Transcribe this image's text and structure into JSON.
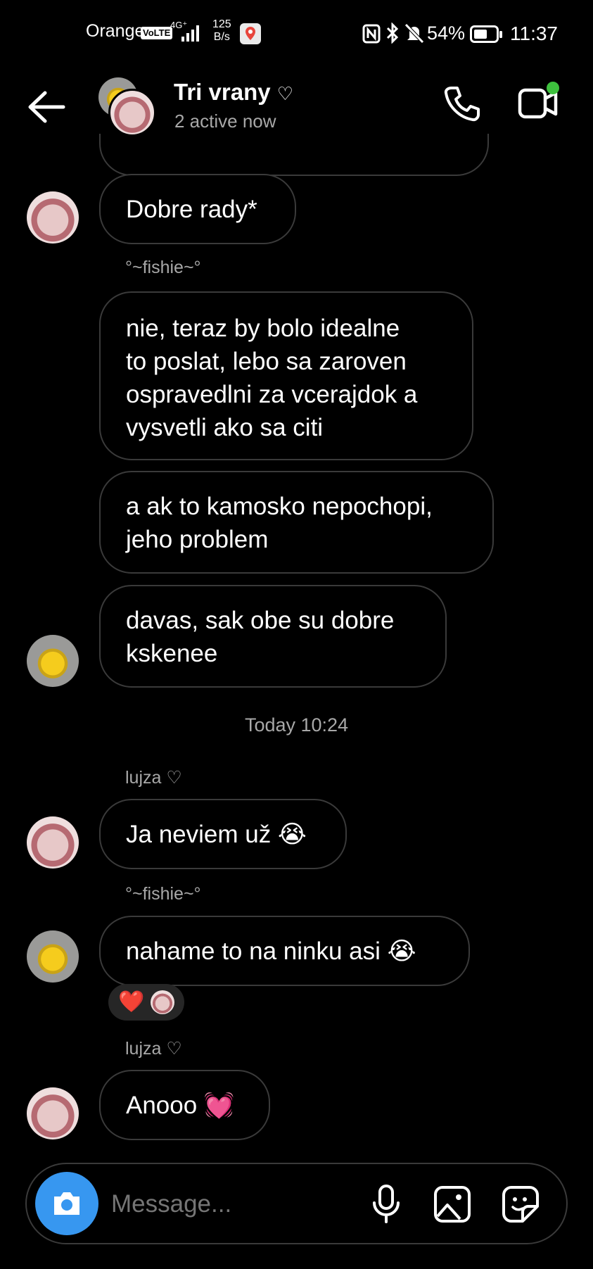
{
  "status": {
    "carrier": "Orange",
    "volte": "VoLTE",
    "network": "4G⁺",
    "speed_value": "125",
    "speed_unit": "B/s",
    "battery": "54%",
    "time": "11:37"
  },
  "header": {
    "title": "Tri vrany",
    "title_heart": "♡",
    "subtitle": "2 active now",
    "accent_online": "#3ec13e"
  },
  "messages": {
    "m1": "Dobre rady*",
    "sender_fishie_1": "°~fishie~°",
    "m2_l1": "nie, teraz by bolo idealne",
    "m2_l2": "to poslat, lebo sa zaroven",
    "m2_l3": "ospravedlni za vcerajdok a",
    "m2_l4": "vysvetli ako sa citi",
    "m3_l1": "a ak to kamosko nepochopi,",
    "m3_l2": "jeho problem",
    "m4_l1": "davas, sak obe su dobre",
    "m4_l2": "kskenee",
    "timestamp": "Today 10:24",
    "sender_lujza_1": "lujza ♡",
    "m5": "Ja neviem už 😭",
    "sender_fishie_2": "°~fishie~°",
    "m6": "nahame to na ninku asi 😭",
    "reaction_emoji": "❤️",
    "sender_lujza_2": "lujza ♡",
    "m7": "Anooo 💓"
  },
  "composer": {
    "placeholder": "Message...",
    "accent": "#3797f0"
  }
}
